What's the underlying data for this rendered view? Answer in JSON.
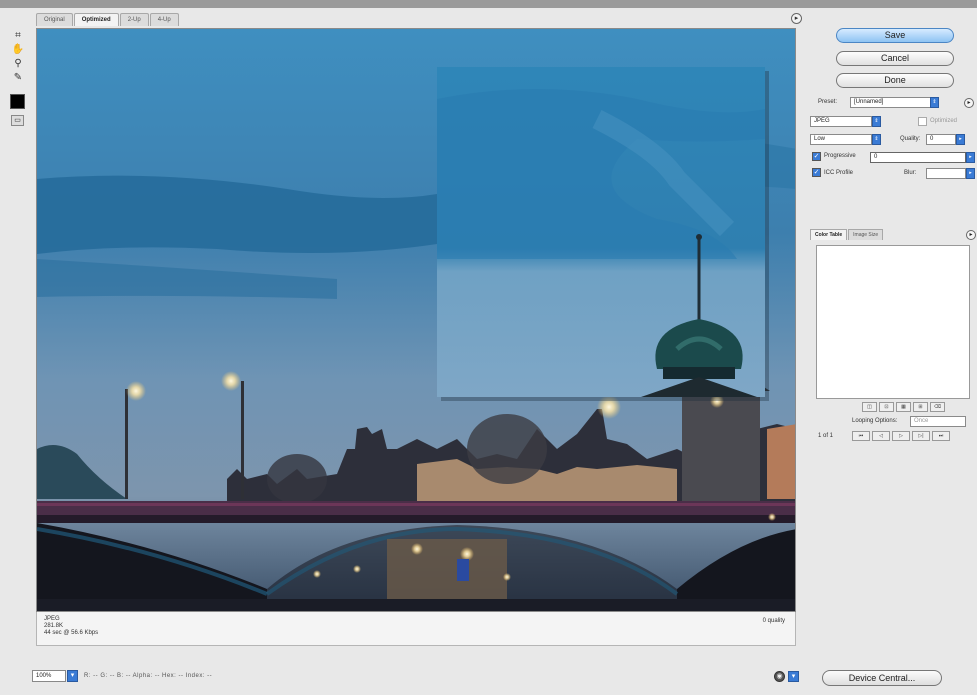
{
  "tabs": [
    {
      "label": "Original",
      "active": false
    },
    {
      "label": "Optimized",
      "active": true
    },
    {
      "label": "2-Up",
      "active": false
    },
    {
      "label": "4-Up",
      "active": false
    }
  ],
  "tools": {
    "icons": [
      "slice-select-icon",
      "hand-icon",
      "zoom-icon",
      "eyedropper-icon"
    ]
  },
  "status": {
    "format": "JPEG",
    "size": "281.8K",
    "time": "44 sec @ 56.6 Kbps",
    "quality": "0 quality"
  },
  "bottombar": {
    "zoom": "100%",
    "readout": "R: -- G: -- B: -- Alpha: -- Hex: -- Index: --",
    "device_central": "Device Central..."
  },
  "buttons": {
    "save": "Save",
    "cancel": "Cancel",
    "done": "Done"
  },
  "settings": {
    "preset_label": "Preset:",
    "preset_value": "[Unnamed]",
    "format_value": "JPEG",
    "optimized_label": "Optimized",
    "compression_value": "Low",
    "quality_label": "Quality:",
    "quality_value": "0",
    "progressive_label": "Progressive",
    "icc_label": "ICC Profile",
    "blur_label": "Blur:",
    "blur_value": "",
    "quality_popup_value": "0"
  },
  "colortable": {
    "tab_color": "Color Table",
    "tab_image": "Image Size",
    "looping_label": "Looping Options:",
    "looping_value": "Once",
    "frame_count": "1 of 1"
  },
  "colors": {
    "accent": "#3a7bd5",
    "primary_button": "#8ec3f3"
  }
}
